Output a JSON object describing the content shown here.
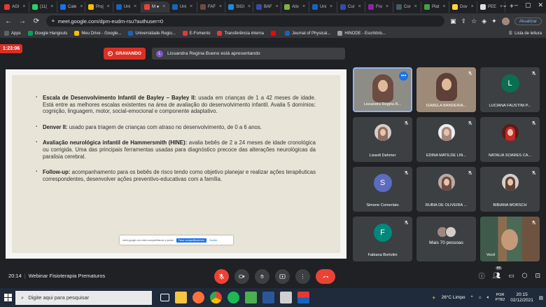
{
  "browser": {
    "tabs": [
      {
        "label": "AGI",
        "color": "#e53935"
      },
      {
        "label": "(11(",
        "color": "#25d366"
      },
      {
        "label": "Cale",
        "color": "#1a73e8"
      },
      {
        "label": "Proj",
        "color": "#fbbc04"
      },
      {
        "label": "Uni",
        "color": "#1565c0"
      },
      {
        "label": "M ●",
        "color": "#ea4335",
        "active": true
      },
      {
        "label": "Uni",
        "color": "#1565c0"
      },
      {
        "label": "FAF",
        "color": "#6d4c41"
      },
      {
        "label": "SIGI",
        "color": "#1e88e5"
      },
      {
        "label": "BAF",
        "color": "#3949ab"
      },
      {
        "label": "Ativ",
        "color": "#7cb342"
      },
      {
        "label": "Uni",
        "color": "#1565c0"
      },
      {
        "label": "Cur",
        "color": "#3949ab"
      },
      {
        "label": "Fro",
        "color": "#8e24aa"
      },
      {
        "label": "Cor",
        "color": "#455a64"
      },
      {
        "label": "Plat",
        "color": "#43a047"
      },
      {
        "label": "Dov",
        "color": "#fdd835"
      },
      {
        "label": "PEE",
        "color": "#e0e0e0"
      }
    ],
    "url": "meet.google.com/dpm-eudm-rsu?authuser=0",
    "update_label": "Atualizar",
    "bookmarks": [
      {
        "label": "Apps",
        "color": "#5f6368"
      },
      {
        "label": "Google Hangouts",
        "color": "#0f9d58"
      },
      {
        "label": "Meu Drive - Google...",
        "color": "#fbbc04"
      },
      {
        "label": "Universidade Regio...",
        "color": "#1565c0"
      },
      {
        "label": "E-Fomento",
        "color": "#e53935"
      },
      {
        "label": "Transferência interna",
        "color": "#e53935"
      },
      {
        "label": "",
        "color": "#ff0000"
      },
      {
        "label": "Journal of Physical...",
        "color": "#1565c0"
      },
      {
        "label": "HINODE - Escritório...",
        "color": "#9e9e9e"
      }
    ],
    "reading_list": "Lista de leitura"
  },
  "meet": {
    "elapsed": "1:23:06",
    "recording_label": "GRAVANDO",
    "presenter_initial": "L",
    "presenter_text": "Lissandra Regina Bueno está apresentando",
    "slide": {
      "bullets": [
        {
          "title": "Escala de Desenvolvimento Infantil de Bayley – Bayley II:",
          "text": " usada em crianças de 1 a 42 meses de idade. Está entre as melhores escalas existentes na área de avaliação do desenvolvimento infantil. Avalia 5 domínios: cognição, linguagem, motor, social-emocional e componente adaptativo."
        },
        {
          "title": "Denver II:",
          "text": " usado para triagem de crianças com atraso no desenvolvimento, de 0 a 6 anos."
        },
        {
          "title": "Avaliação neurológica infantil de Hammersmith (HINE):",
          "text": " avalia bebês de 2 a 24 meses de idade cronológica ou corrigida. Uma das principais ferramentas usadas para diagnóstico precoce das alterações neurológicas da paralisia cerebral."
        },
        {
          "title": "Follow-up:",
          "text": " acompanhamento para os bebês de risco tendo como objetivo planejar e realizar ações terapêuticas correspondentes, desenvolver ações preventivo-educativas com a família."
        }
      ],
      "share_bar": {
        "text": "meet.google.com está compartilhando a janela",
        "stop": "Parar compartilhamento",
        "hide": "Ocultar"
      }
    },
    "participants": [
      {
        "name": "Lissandra Regina B...",
        "type": "photo",
        "tone": "#6d4c41",
        "bg": "#8d8d86"
      },
      {
        "name": "ISABELA BANDEIRA...",
        "type": "photo",
        "tone": "#5d4037",
        "bg": "#9e8a78"
      },
      {
        "name": "LUCIANA FAUSTINI P...",
        "type": "initial",
        "initial": "L",
        "color": "#0b6e4f"
      },
      {
        "name": "Lizardi Dahmer",
        "type": "photo",
        "tone": "#8d6e63",
        "bg": "#d7ccc8"
      },
      {
        "name": "EDINA MATILDE LIN...",
        "type": "photo",
        "tone": "#a1887f",
        "bg": "#eeeeee"
      },
      {
        "name": "NATALIA SOARES CA...",
        "type": "photo",
        "tone": "#c62828",
        "bg": "#5d1a1a"
      },
      {
        "name": "Simone Comerlato",
        "type": "initial",
        "initial": "S",
        "color": "#5c6bc0"
      },
      {
        "name": "RÚBIA DE OLIVEIRA ...",
        "type": "photo",
        "tone": "#6d4c41",
        "bg": "#bcaaa4"
      },
      {
        "name": "BIBIANA MORSCH",
        "type": "photo",
        "tone": "#5d4037",
        "bg": "#d7ccc8"
      },
      {
        "name": "Fabiana Bortolini",
        "type": "initial",
        "initial": "F",
        "color": "#00897b"
      },
      {
        "name": "Mais 70 pessoas",
        "type": "more"
      },
      {
        "name": "Você",
        "type": "self"
      }
    ],
    "clock": "20:14",
    "meeting_title": "Webinar Fisioterapia Prematuros",
    "people_count": "82"
  },
  "taskbar": {
    "search_placeholder": "Digite aqui para pesquisar",
    "weather": "26°C  Limpo",
    "lang_top": "POR",
    "lang_bottom": "PTB2",
    "time": "20:15",
    "date": "02/12/2021"
  }
}
